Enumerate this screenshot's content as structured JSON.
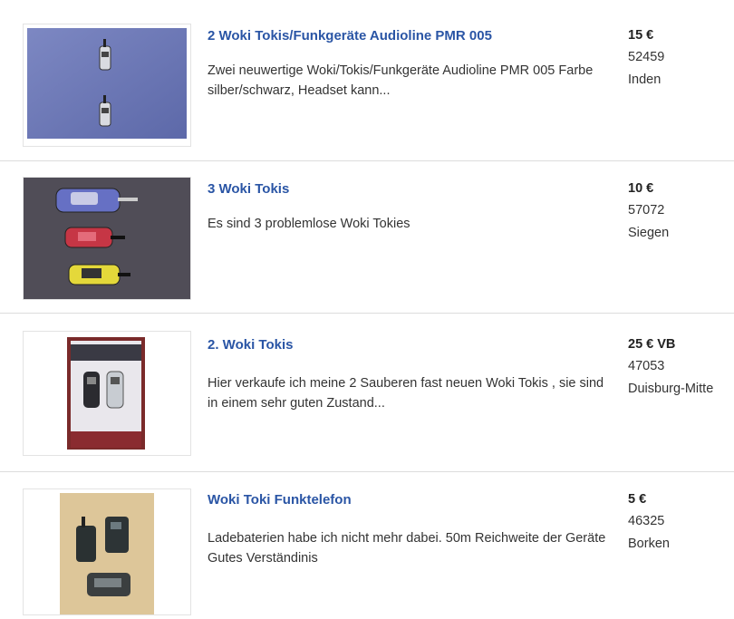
{
  "listings": [
    {
      "title": "2 Woki Tokis/Funkgeräte Audioline PMR 005",
      "description": "Zwei neuwertige Woki/Tokis/Funkgeräte Audioline PMR 005 Farbe silber/schwarz, Headset kann...",
      "price": "15 €",
      "zip": "52459",
      "city": "Inden"
    },
    {
      "title": "3 Woki Tokis",
      "description": "Es sind 3 problemlose Woki Tokies",
      "price": "10 €",
      "zip": "57072",
      "city": "Siegen"
    },
    {
      "title": "2. Woki Tokis",
      "description": "Hier verkaufe ich meine 2 Sauberen fast neuen Woki Tokis , sie sind in einem sehr guten Zustand...",
      "price": "25 € VB",
      "zip": "47053",
      "city": "Duisburg-Mitte"
    },
    {
      "title": "Woki Toki Funktelefon",
      "description": "Ladebaterien habe ich nicht mehr dabei. 50m Reichweite der Geräte Gutes Verständinis",
      "price": "5 €",
      "zip": "46325",
      "city": "Borken"
    }
  ],
  "colors": {
    "title_link": "#2a55a5",
    "text": "#333333",
    "divider": "#dcdcdc"
  }
}
